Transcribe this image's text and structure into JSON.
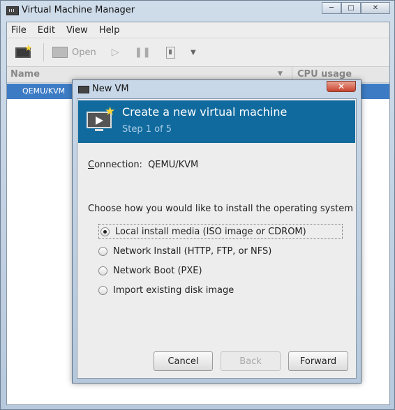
{
  "window": {
    "title": "Virtual Machine Manager"
  },
  "menubar": {
    "items": [
      "File",
      "Edit",
      "View",
      "Help"
    ]
  },
  "toolbar": {
    "open_label": "Open"
  },
  "vm_list": {
    "columns": [
      "Name",
      "CPU usage"
    ],
    "rows": [
      "QEMU/KVM"
    ]
  },
  "dialog": {
    "title": "New VM",
    "header": "Create a new virtual machine",
    "step": "Step 1 of 5",
    "connection_label": "Connection:",
    "connection_value": "QEMU/KVM",
    "prompt": "Choose how you would like to install the operating system",
    "options": [
      {
        "label": "Local install media (ISO image or CDROM)",
        "checked": true
      },
      {
        "label": "Network Install (HTTP, FTP, or NFS)",
        "checked": false
      },
      {
        "label": "Network Boot (PXE)",
        "checked": false
      },
      {
        "label": "Import existing disk image",
        "checked": false
      }
    ],
    "buttons": {
      "cancel": "Cancel",
      "back": "Back",
      "forward": "Forward"
    }
  },
  "colors": {
    "banner": "#106a9e",
    "selection": "#3d7cc5"
  }
}
